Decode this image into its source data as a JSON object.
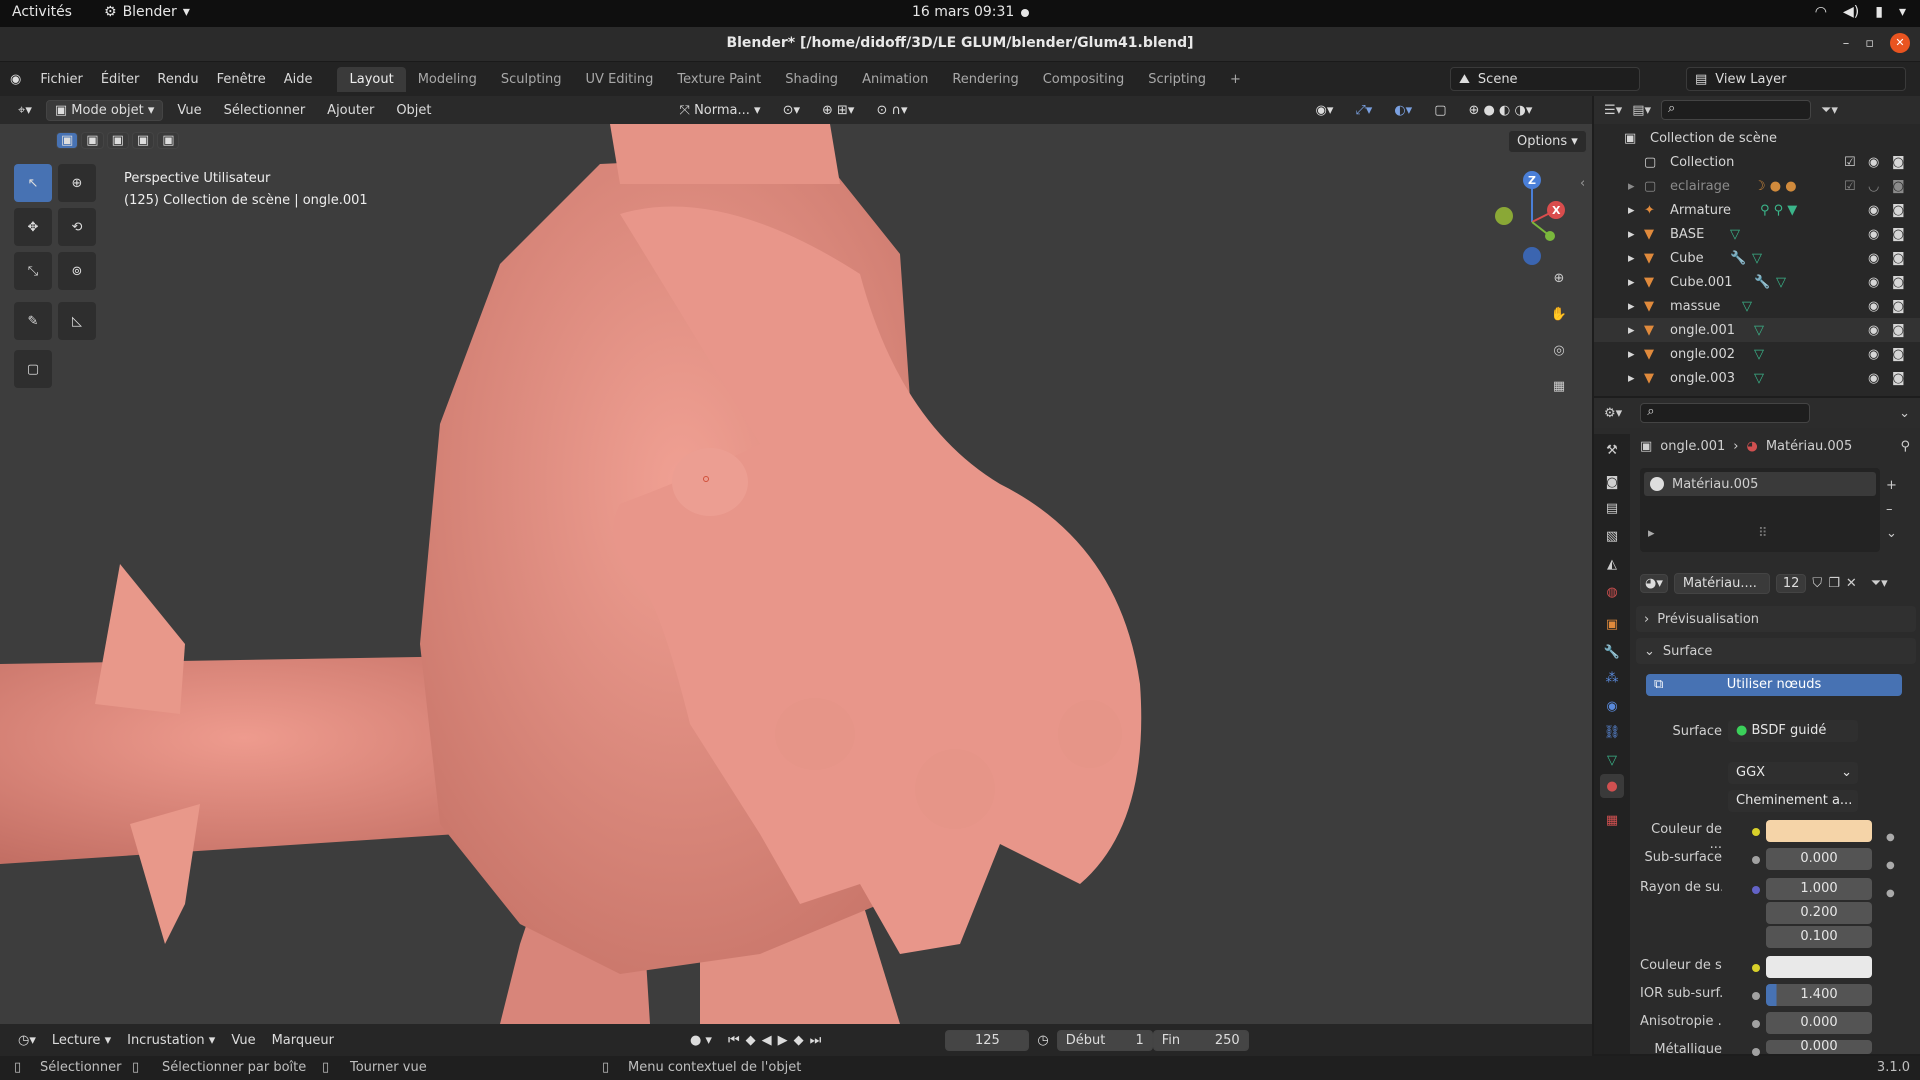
{
  "gnome": {
    "activities": "Activités",
    "app": "Blender",
    "clock": "16 mars  09:31"
  },
  "window": {
    "title": "Blender* [/home/didoff/3D/LE GLUM/blender/Glum41.blend]"
  },
  "menus": [
    "Fichier",
    "Éditer",
    "Rendu",
    "Fenêtre",
    "Aide"
  ],
  "workspaces": [
    "Layout",
    "Modeling",
    "Sculpting",
    "UV Editing",
    "Texture Paint",
    "Shading",
    "Animation",
    "Rendering",
    "Compositing",
    "Scripting"
  ],
  "active_workspace": "Layout",
  "scene": {
    "scene_name": "Scene",
    "view_layer": "View Layer"
  },
  "viewport_header": {
    "mode": "Mode objet",
    "vue": "Vue",
    "select": "Sélectionner",
    "add": "Ajouter",
    "object": "Objet",
    "orientation": "Norma...",
    "options": "Options"
  },
  "viewport": {
    "view_name": "Perspective Utilisateur",
    "collection_info": "(125) Collection de scène | ongle.001"
  },
  "gizmo": {
    "z": "Z",
    "x": "X"
  },
  "outliner": {
    "root": "Collection de scène",
    "items": [
      {
        "name": "Collection"
      },
      {
        "name": "eclairage"
      },
      {
        "name": "Armature"
      },
      {
        "name": "BASE"
      },
      {
        "name": "Cube"
      },
      {
        "name": "Cube.001"
      },
      {
        "name": "massue"
      },
      {
        "name": "ongle.001"
      },
      {
        "name": "ongle.002"
      },
      {
        "name": "ongle.003"
      }
    ]
  },
  "properties": {
    "breadcrumb_object": "ongle.001",
    "breadcrumb_material": "Matériau.005",
    "slot": "Matériau.005",
    "material_name": "Matériau....",
    "users": "12",
    "preview_label": "Prévisualisation",
    "surface_panel": "Surface",
    "use_nodes": "Utiliser nœuds",
    "surface_label": "Surface",
    "surface_value": "BSDF guidé",
    "distribution": "GGX",
    "subsurface_method": "Cheminement a...",
    "rows": [
      {
        "label": "Couleur de ...",
        "value": "",
        "color": "#f5d4a8"
      },
      {
        "label": "Sub-surface",
        "value": "0.000"
      },
      {
        "label": "Rayon de su...",
        "value": "1.000"
      },
      {
        "label": "",
        "value": "0.200"
      },
      {
        "label": "",
        "value": "0.100"
      },
      {
        "label": "Couleur de s...",
        "value": "",
        "color": "#e9e9e9"
      },
      {
        "label": "IOR sub-surf...",
        "value": "1.400"
      },
      {
        "label": "Anisotropie ...",
        "value": "0.000"
      },
      {
        "label": "Métallique",
        "value": "0.000"
      }
    ]
  },
  "timeline": {
    "playback": "Lecture",
    "keying": "Incrustation",
    "view": "Vue",
    "marker": "Marqueur",
    "frame": "125",
    "start_label": "Début",
    "start": "1",
    "end_label": "Fin",
    "end": "250"
  },
  "status": {
    "select": "Sélectionner",
    "box": "Sélectionner par boîte",
    "rotate": "Tourner vue",
    "context": "Menu contextuel de l'objet",
    "version": "3.1.0"
  },
  "colors": {
    "accent": "#4772b3",
    "skin": "#e38d80",
    "bg_viewport": "#3d3d3d"
  }
}
